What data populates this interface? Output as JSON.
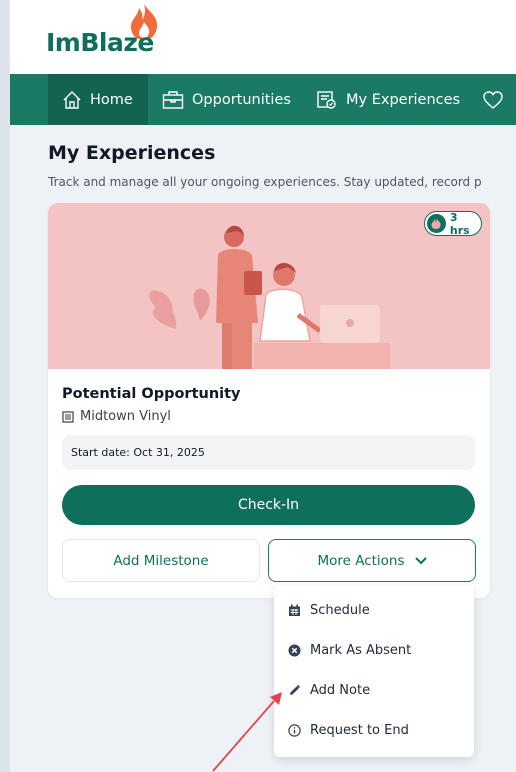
{
  "brand": {
    "logo_text": "ImBlaze"
  },
  "nav": {
    "items": [
      {
        "label": "Home",
        "icon": "home-icon",
        "active": true
      },
      {
        "label": "Opportunities",
        "icon": "briefcase-icon"
      },
      {
        "label": "My Experiences",
        "icon": "experiences-icon"
      },
      {
        "label": "",
        "icon": "heart-icon"
      }
    ]
  },
  "page": {
    "title": "My Experiences",
    "description": "Track and manage all your ongoing experiences. Stay updated, record p"
  },
  "card": {
    "hours_badge": "3 hrs",
    "title": "Potential Opportunity",
    "company": "Midtown Vinyl",
    "start_date": "Start date: Oct 31, 2025",
    "checkin_label": "Check-In",
    "milestone_label": "Add Milestone",
    "more_actions_label": "More Actions"
  },
  "dropdown": {
    "items": [
      {
        "label": "Schedule",
        "icon": "calendar-icon"
      },
      {
        "label": "Mark As Absent",
        "icon": "x-circle-icon"
      },
      {
        "label": "Add Note",
        "icon": "pencil-icon"
      },
      {
        "label": "Request to End",
        "icon": "info-icon"
      }
    ]
  },
  "colors": {
    "brand_green": "#0e6f5c",
    "nav_bg": "#1a7a66",
    "hero_bg": "#f4c4c4",
    "arrow": "#e0464a",
    "flame": "#f26b3a"
  }
}
